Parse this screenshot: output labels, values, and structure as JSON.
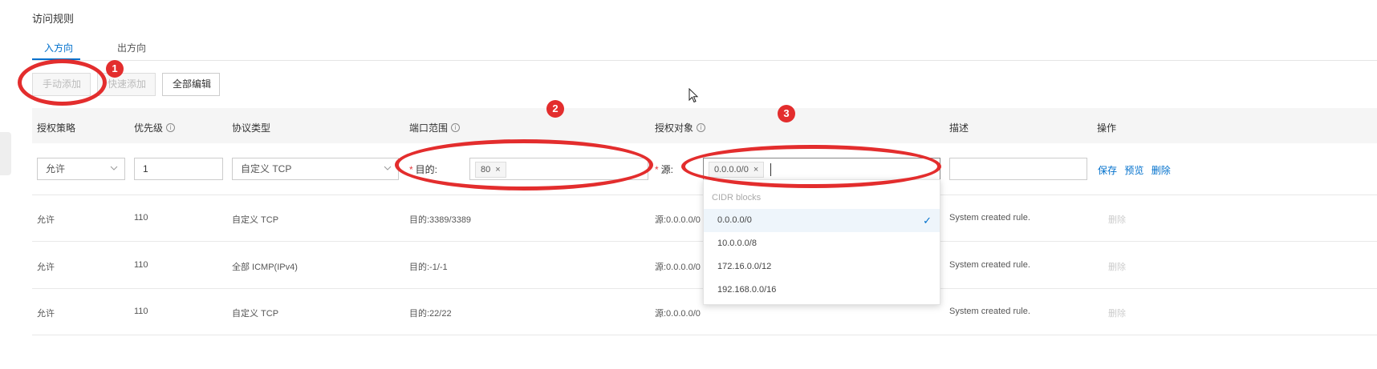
{
  "page": {
    "title": "访问规则"
  },
  "tabs": [
    {
      "label": "入方向"
    },
    {
      "label": "出方向"
    }
  ],
  "toolbar": {
    "manual_add": "手动添加",
    "quick_add": "快速添加",
    "edit_all": "全部编辑"
  },
  "columns": {
    "policy": "授权策略",
    "priority": "优先级",
    "protocol": "协议类型",
    "port_range": "端口范围",
    "auth_object": "授权对象",
    "description": "描述",
    "actions": "操作"
  },
  "edit_row": {
    "policy": "允许",
    "priority": "1",
    "protocol": "自定义 TCP",
    "dest_label": "目的:",
    "port_tag": "80",
    "source_label": "源:",
    "source_tag": "0.0.0.0/0",
    "description": "",
    "save": "保存",
    "preview": "预览",
    "delete": "删除"
  },
  "rows": [
    {
      "policy": "允许",
      "priority": "110",
      "protocol": "自定义 TCP",
      "port": "目的:3389/3389",
      "source": "源:0.0.0.0/0",
      "description": "System created rule.",
      "action": "删除"
    },
    {
      "policy": "允许",
      "priority": "110",
      "protocol": "全部 ICMP(IPv4)",
      "port": "目的:-1/-1",
      "source": "源:0.0.0.0/0",
      "description": "System created rule.",
      "action": "删除"
    },
    {
      "policy": "允许",
      "priority": "110",
      "protocol": "自定义 TCP",
      "port": "目的:22/22",
      "source": "源:0.0.0.0/0",
      "description": "System created rule.",
      "action": "删除"
    }
  ],
  "dropdown": {
    "header": "CIDR blocks",
    "items": [
      {
        "label": "0.0.0.0/0"
      },
      {
        "label": "10.0.0.0/8"
      },
      {
        "label": "172.16.0.0/12"
      },
      {
        "label": "192.168.0.0/16"
      }
    ],
    "check": "✓"
  },
  "markers": [
    "1",
    "2",
    "3"
  ],
  "colors": {
    "accent": "#0070cc",
    "annotation": "#e32d2d"
  }
}
